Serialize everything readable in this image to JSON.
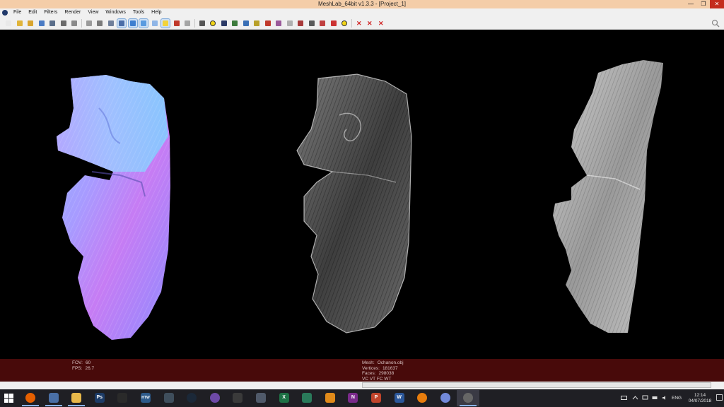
{
  "window": {
    "title": "MeshLab_64bit v1.3.3 - [Project_1]",
    "controls": {
      "minimize": "—",
      "maximize": "❐",
      "close": "✕"
    }
  },
  "menu": {
    "items": [
      "File",
      "Edit",
      "Filters",
      "Render",
      "View",
      "Windows",
      "Tools",
      "Help"
    ]
  },
  "toolbar": {
    "tools": [
      {
        "icon": "new-file-icon",
        "color": "#e9e9e9"
      },
      {
        "icon": "open-folder-icon",
        "color": "#e0b43a"
      },
      {
        "icon": "open-project-icon",
        "color": "#d9a52e"
      },
      {
        "icon": "reload-icon",
        "color": "#4a7bc4"
      },
      {
        "icon": "save-icon",
        "color": "#5a6e8a"
      },
      {
        "icon": "snapshot-icon",
        "color": "#6b6b6b"
      },
      {
        "icon": "print-icon",
        "color": "#8a8a8a"
      },
      {
        "icon": "bbox-icon",
        "color": "#9a9a9a"
      },
      {
        "icon": "points-icon",
        "color": "#7a7a7a"
      },
      {
        "icon": "wireframe-icon",
        "color": "#6f7f9a"
      },
      {
        "icon": "hidden-lines-icon",
        "color": "#4b6ea8"
      },
      {
        "icon": "flat-icon",
        "color": "#3e7fd0"
      },
      {
        "icon": "smooth-icon",
        "color": "#5a9be0"
      },
      {
        "icon": "texture-icon",
        "color": "#8fb5e6"
      },
      {
        "icon": "light-bulb-icon",
        "color": "#f2d33a"
      },
      {
        "icon": "two-side-light-icon",
        "color": "#c0392b"
      },
      {
        "icon": "back-face-icon",
        "color": "#a5a5a5"
      },
      {
        "icon": "crosshair-icon",
        "color": "#555555"
      },
      {
        "icon": "annotate-icon",
        "color": "#f1d417"
      },
      {
        "icon": "layers-icon",
        "color": "#2b3a66"
      },
      {
        "icon": "globe-icon",
        "color": "#3c7a3c"
      },
      {
        "icon": "measure-icon",
        "color": "#3a6fb5"
      },
      {
        "icon": "pick-points-icon",
        "color": "#b8a02a"
      },
      {
        "icon": "paint-icon",
        "color": "#c0392b"
      },
      {
        "icon": "select-faces-icon",
        "color": "#9a5a9a"
      },
      {
        "icon": "select-vertices-icon",
        "color": "#b0b0b0"
      },
      {
        "icon": "manipulator-icon",
        "color": "#a83a3a"
      },
      {
        "icon": "align-icon",
        "color": "#5a5a5a"
      },
      {
        "icon": "z-paint-icon",
        "color": "#c04040"
      },
      {
        "icon": "quality-icon",
        "color": "#cc3333"
      },
      {
        "icon": "info-icon",
        "color": "#f1d417"
      },
      {
        "icon": "delete-vertices-icon",
        "color": "#d12b2b"
      },
      {
        "icon": "delete-faces-icon",
        "color": "#d12b2b"
      },
      {
        "icon": "delete-selection-icon",
        "color": "#d12b2b"
      }
    ]
  },
  "info": {
    "left": [
      {
        "label": "FOV:",
        "value": "60"
      },
      {
        "label": "FPS:",
        "value": "26.7"
      }
    ],
    "mesh": [
      {
        "label": "Mesh:",
        "value": "Ochanon.obj"
      },
      {
        "label": "Vertices:",
        "value": "181637"
      },
      {
        "label": "Faces:",
        "value": "298038"
      },
      {
        "label": "VC VT FC WT",
        "value": ""
      }
    ]
  },
  "taskbar": {
    "apps": [
      {
        "icon": "firefox-icon",
        "color": "#e66000",
        "glyph": ""
      },
      {
        "icon": "app-icon",
        "color": "#4a6fa5",
        "glyph": ""
      },
      {
        "icon": "file-explorer-icon",
        "color": "#e8b84a",
        "glyph": ""
      },
      {
        "icon": "photoshop-icon",
        "color": "#1c3b66",
        "glyph": "Ps"
      },
      {
        "icon": "unity-icon",
        "color": "#2a2a2a",
        "glyph": ""
      },
      {
        "icon": "htw-icon",
        "color": "#2d5a8a",
        "glyph": "HTW"
      },
      {
        "icon": "game-icon",
        "color": "#3f4e5c",
        "glyph": ""
      },
      {
        "icon": "steam-icon",
        "color": "#1b2838",
        "glyph": ""
      },
      {
        "icon": "mass-effect-icon",
        "color": "#6e4aa8",
        "glyph": ""
      },
      {
        "icon": "app2-icon",
        "color": "#3a3a3a",
        "glyph": ""
      },
      {
        "icon": "app3-icon",
        "color": "#505a6a",
        "glyph": ""
      },
      {
        "icon": "excel-icon",
        "color": "#1e7145",
        "glyph": "X"
      },
      {
        "icon": "green-app-icon",
        "color": "#2a7a5a",
        "glyph": ""
      },
      {
        "icon": "audible-icon",
        "color": "#e08a1a",
        "glyph": ""
      },
      {
        "icon": "onenote-icon",
        "color": "#7a2a8a",
        "glyph": "N"
      },
      {
        "icon": "powerpoint-icon",
        "color": "#c0442b",
        "glyph": "P"
      },
      {
        "icon": "word-icon",
        "color": "#2b579a",
        "glyph": "W"
      },
      {
        "icon": "blender-icon",
        "color": "#e87d0d",
        "glyph": ""
      },
      {
        "icon": "discord-icon",
        "color": "#7289da",
        "glyph": ""
      },
      {
        "icon": "meshlab-icon",
        "color": "#666666",
        "glyph": ""
      }
    ],
    "language": "ENG",
    "time": "12:14",
    "date": "04/07/2018"
  }
}
